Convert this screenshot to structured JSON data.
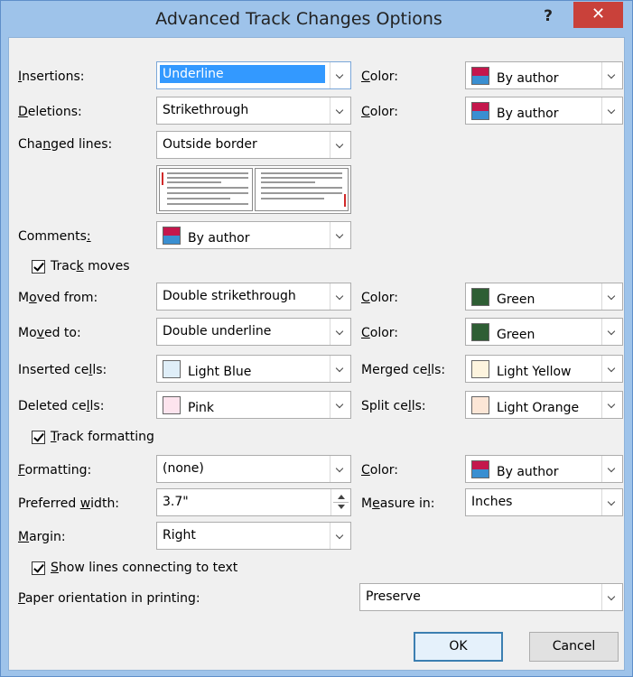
{
  "window": {
    "title": "Advanced Track Changes Options",
    "help_label": "?",
    "close_label": "✕"
  },
  "fields": {
    "insertions": {
      "label_u": "I",
      "label_rest": "nsertions:",
      "value": "Underline"
    },
    "insertions_color": {
      "label_u": "C",
      "label_rest": "olor:",
      "value": "By author"
    },
    "deletions": {
      "label_u": "D",
      "label_rest": "eletions:",
      "value": "Strikethrough"
    },
    "deletions_color": {
      "label_u": "C",
      "label_rest": "olor:",
      "value": "By author"
    },
    "changed_lines": {
      "label_pre": "Cha",
      "label_u": "n",
      "label_rest": "ged lines:",
      "value": "Outside border"
    },
    "comments": {
      "label_pre": "Comments",
      "label_u": ":",
      "value": "By author"
    },
    "track_moves": {
      "label_pre": "Trac",
      "label_u": "k",
      "label_rest": " moves",
      "checked": true
    },
    "moved_from": {
      "label_pre": "M",
      "label_u": "o",
      "label_rest": "ved from:",
      "value": "Double strikethrough"
    },
    "moved_from_color": {
      "label_u": "C",
      "label_rest": "olor:",
      "value": "Green"
    },
    "moved_to": {
      "label_pre": "Mo",
      "label_u": "v",
      "label_rest": "ed to:",
      "value": "Double underline"
    },
    "moved_to_color": {
      "label_u": "C",
      "label_rest": "olor:",
      "value": "Green"
    },
    "inserted_cells": {
      "label_pre": "Inserted ce",
      "label_u": "l",
      "label_rest": "ls:",
      "value": "Light Blue"
    },
    "merged_cells": {
      "label_pre": "Merged ce",
      "label_u": "l",
      "label_rest": "ls:",
      "value": "Light Yellow"
    },
    "deleted_cells": {
      "label_pre": "Deleted ce",
      "label_u": "l",
      "label_rest": "ls:",
      "value": "Pink"
    },
    "split_cells": {
      "label_pre": "Split ce",
      "label_u": "l",
      "label_rest": "ls:",
      "value": "Light Orange"
    },
    "track_formatting": {
      "label_u": "T",
      "label_rest": "rack formatting",
      "checked": true
    },
    "formatting": {
      "label_u": "F",
      "label_rest": "ormatting:",
      "value": "(none)"
    },
    "formatting_color": {
      "label_u": "C",
      "label_rest": "olor:",
      "value": "By author"
    },
    "preferred_width": {
      "label_pre": "Preferred ",
      "label_u": "w",
      "label_rest": "idth:",
      "value": "3.7\""
    },
    "measure_in": {
      "label_pre": "M",
      "label_u": "e",
      "label_rest": "asure in:",
      "value": "Inches"
    },
    "margin": {
      "label_u": "M",
      "label_rest": "argin:",
      "value": "Right"
    },
    "show_lines": {
      "label_u": "S",
      "label_rest": "how lines connecting to text",
      "checked": true
    },
    "paper_orientation": {
      "label_u": "P",
      "label_rest": "aper orientation in printing:",
      "value": "Preserve"
    }
  },
  "colors": {
    "green": "#2e5e34",
    "light_blue": "#dfeef8",
    "light_yellow": "#fdf4de",
    "pink": "#fde4ee",
    "light_orange": "#fce6d6",
    "by_author_top": "#c4174c",
    "by_author_bottom": "#3a8fd1"
  },
  "buttons": {
    "ok": "OK",
    "cancel": "Cancel"
  }
}
